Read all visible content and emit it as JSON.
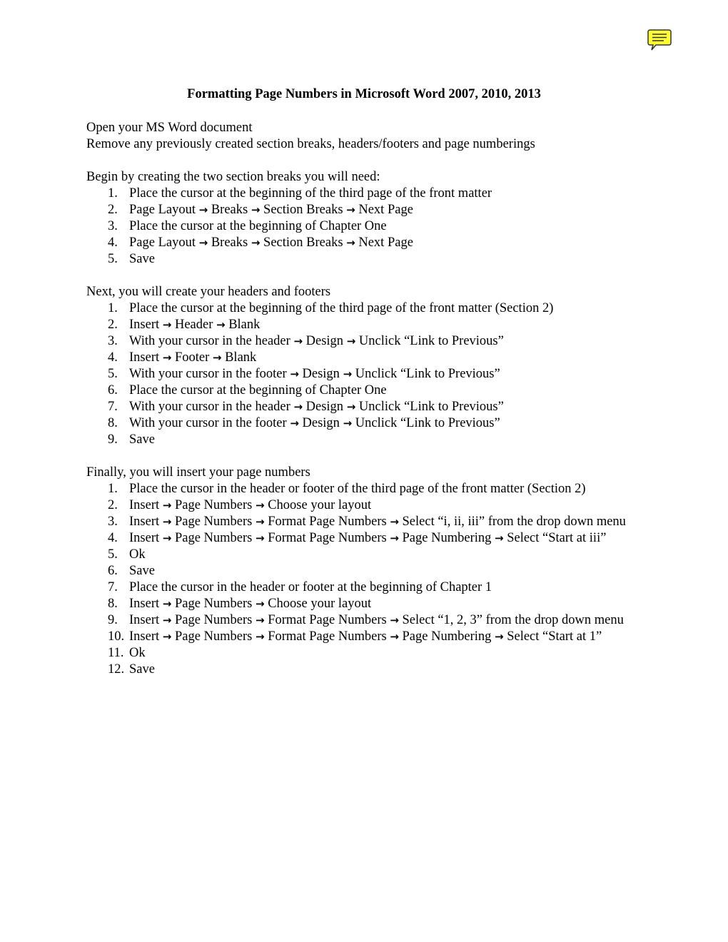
{
  "comment_icon": {
    "name": "comment-note-icon",
    "color": "#FFFF33"
  },
  "title": "Formatting Page Numbers in Microsoft Word 2007, 2010, 2013",
  "intro": [
    "Open your MS Word document",
    "Remove any previously created section breaks, headers/footers and page numberings"
  ],
  "sections": [
    {
      "heading": "Begin by creating the two section breaks you will need:",
      "steps": [
        {
          "num": "1.",
          "text": "Place the cursor at the beginning of the third page of the front matter"
        },
        {
          "num": "2.",
          "text": "Page Layout → Breaks → Section Breaks → Next Page"
        },
        {
          "num": "3.",
          "text": "Place the cursor at the beginning of Chapter One"
        },
        {
          "num": "4.",
          "text": "Page Layout → Breaks → Section Breaks → Next Page"
        },
        {
          "num": "5.",
          "text": "Save"
        }
      ]
    },
    {
      "heading": "Next, you will create your headers and footers",
      "steps": [
        {
          "num": "1.",
          "text": "Place the cursor at the beginning of the third page of the front matter (Section 2)"
        },
        {
          "num": "2.",
          "text": "Insert → Header → Blank"
        },
        {
          "num": "3.",
          "text": "With your cursor in the header → Design → Unclick “Link to Previous”"
        },
        {
          "num": "4.",
          "text": "Insert → Footer → Blank"
        },
        {
          "num": "5.",
          "text": "With your cursor in the footer → Design → Unclick “Link to Previous”"
        },
        {
          "num": "6.",
          "text": "Place the cursor at the beginning of Chapter One"
        },
        {
          "num": "7.",
          "text": "With your cursor in the header → Design → Unclick “Link to Previous”"
        },
        {
          "num": "8.",
          "text": "With your cursor in the footer → Design → Unclick “Link to Previous”"
        },
        {
          "num": "9.",
          "text": "Save"
        }
      ]
    },
    {
      "heading": "Finally, you will insert your page numbers",
      "steps": [
        {
          "num": "1.",
          "text": "Place the cursor in the header or footer of the third page of the front matter (Section 2)"
        },
        {
          "num": "2.",
          "text": "Insert → Page Numbers → Choose your layout"
        },
        {
          "num": "3.",
          "text": "Insert → Page Numbers → Format Page Numbers → Select “i, ii, iii” from the drop down menu"
        },
        {
          "num": "4.",
          "text": "Insert → Page Numbers → Format Page Numbers → Page Numbering → Select “Start at iii”"
        },
        {
          "num": "5.",
          "text": "Ok"
        },
        {
          "num": "6.",
          "text": "Save"
        },
        {
          "num": "7.",
          "text": "Place the cursor in the header or footer at the beginning of Chapter 1"
        },
        {
          "num": "8.",
          "text": "Insert → Page Numbers → Choose your layout"
        },
        {
          "num": "9.",
          "text": "Insert → Page Numbers → Format Page Numbers → Select “1, 2, 3” from the drop down menu"
        },
        {
          "num": "10.",
          "text": "Insert → Page Numbers → Format Page Numbers → Page Numbering → Select “Start at 1”"
        },
        {
          "num": "11.",
          "text": "Ok"
        },
        {
          "num": "12.",
          "text": "Save"
        }
      ]
    }
  ]
}
